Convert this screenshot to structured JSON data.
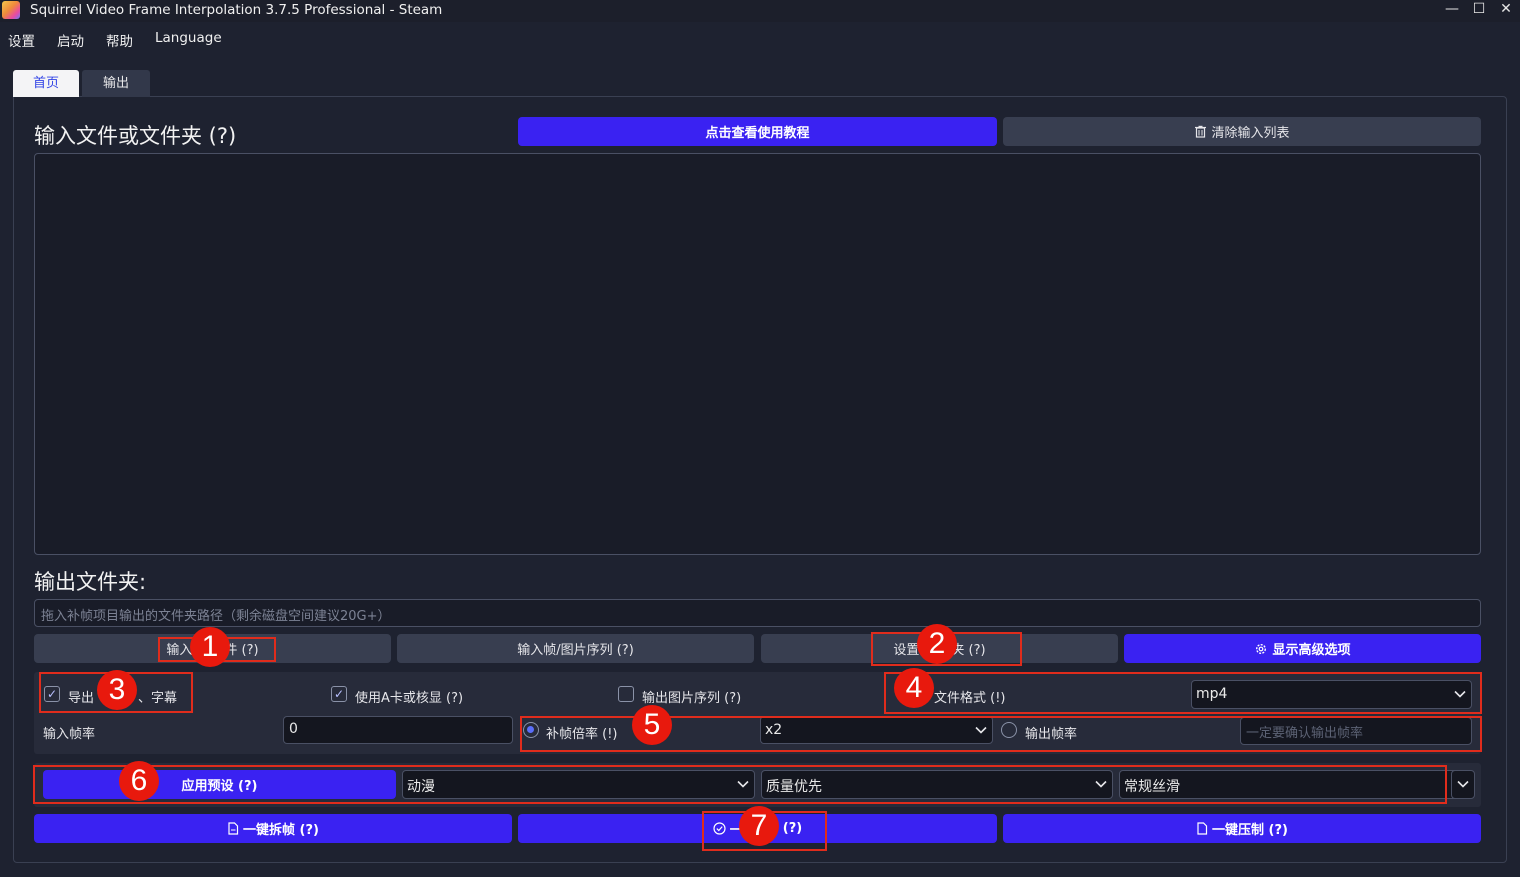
{
  "window": {
    "title": "Squirrel Video Frame Interpolation 3.7.5 Professional - Steam",
    "minimize": "—",
    "maximize": "☐",
    "close": "✕"
  },
  "menu": {
    "settings": "设置",
    "launch": "启动",
    "help": "帮助",
    "language": "Language"
  },
  "tabs": {
    "home": "首页",
    "output": "输出"
  },
  "input": {
    "title": "输入文件或文件夹 (?)",
    "tutorial_button": "点击查看使用教程",
    "clear_button": "清除输入列表"
  },
  "output": {
    "title": "输出文件夹:",
    "path_placeholder": "拖入补帧项目输出的文件夹路径（剩余磁盘空间建议20G+）"
  },
  "buttons": {
    "input_file": "输入",
    "input_file_suffix": "件 (?)",
    "input_frames": "输入帧/图片序列 (?)",
    "set_output_folder": "设置",
    "set_output_folder_suffix": "夹 (?)",
    "show_advanced": "显示高级选项"
  },
  "options": {
    "export_audio_label": "导出",
    "export_audio_suffix": "、字幕",
    "export_audio_checked": true,
    "amd_card_label": "使用A卡或核显 (?)",
    "amd_card_checked": true,
    "output_image_seq_label": "输出图片序列 (?)",
    "output_image_seq_checked": false,
    "file_format_label": "文件格式 (!)",
    "file_format_value": "mp4",
    "input_fps_label": "输入帧率",
    "input_fps_value": "0",
    "interp_ratio_label": "补帧倍率 (!)",
    "interp_ratio_value": "x2",
    "output_fps_label": "输出帧率",
    "output_fps_placeholder": "一定要确认输出帧率"
  },
  "preset": {
    "apply_button": "应用预设 (?)",
    "type_value": "动漫",
    "quality_value": "质量优先",
    "smooth_value": "常规丝滑"
  },
  "actions": {
    "split_button": "一键拆帧 (?)",
    "start_prefix": "一",
    "start_suffix": "(?)",
    "compress_button": "一键压制 (?)"
  },
  "annotations": [
    "1",
    "2",
    "3",
    "4",
    "5",
    "6",
    "7"
  ],
  "colors": {
    "accent_blue": "#3a22f2",
    "annotation_red": "#e8190d",
    "background": "#1e2230"
  }
}
